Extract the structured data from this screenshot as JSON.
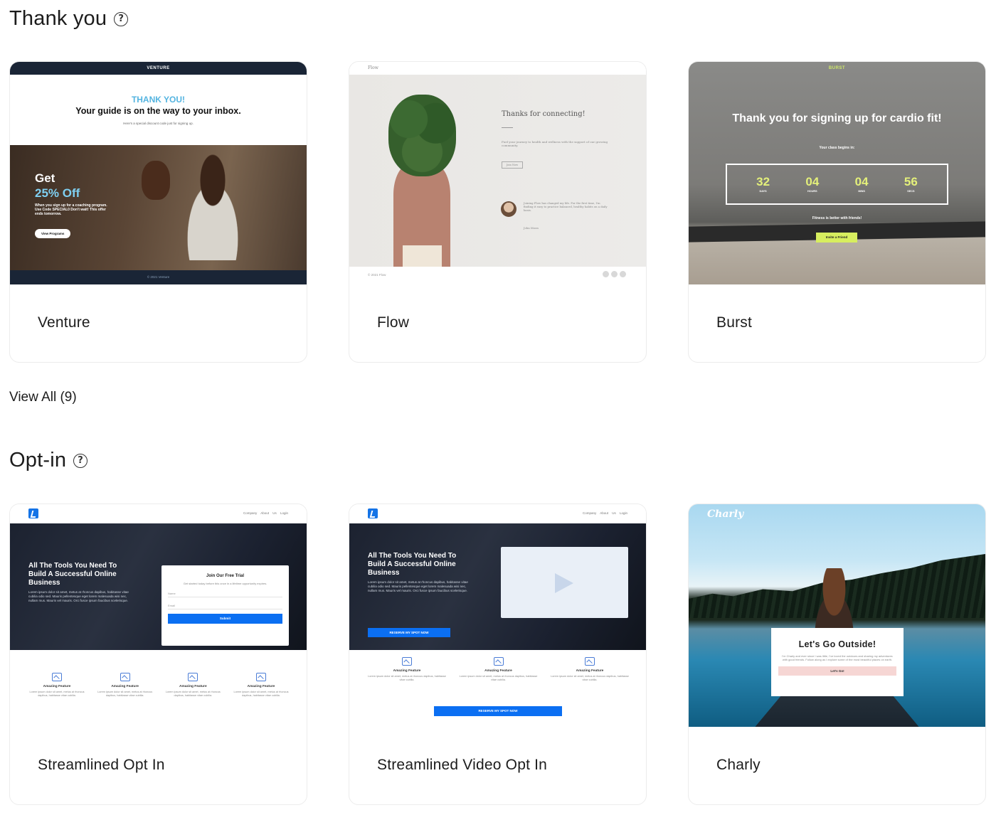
{
  "sections": {
    "thank_you": {
      "title": "Thank you",
      "view_all": "View All (9)",
      "cards": [
        {
          "label": "Venture",
          "preview": {
            "brand": "VENTURE",
            "heading": "THANK YOU!",
            "subheading": "Your guide is on the way to your inbox.",
            "small": "Here's a special discount code just for signing up.",
            "promo_get": "Get",
            "promo_off": "25% Off",
            "promo_copy": "When you sign up for a coaching program. Use Code SPECIAL0 Don't wait! This offer ends tomorrow.",
            "button": "View Programs",
            "footer": "© 2021 Venture"
          }
        },
        {
          "label": "Flow",
          "preview": {
            "brand": "Flow",
            "heading": "Thanks for connecting!",
            "body": "Fuel your journey to health and wellness with the support of our growing community.",
            "button": "Join Now",
            "quote": "Joining Flow has changed my life. For the first time, I'm finding it easy to practice balanced, healthy habits on a daily basis.",
            "author": "John Moon",
            "footer": "© 2021 Flow"
          }
        },
        {
          "label": "Burst",
          "preview": {
            "brand": "BURST",
            "heading": "Thank you for signing up for cardio fit!",
            "subheading": "Your class begins in:",
            "countdown": [
              {
                "value": "32",
                "unit": "DAYS"
              },
              {
                "value": "04",
                "unit": "HOURS"
              },
              {
                "value": "04",
                "unit": "MINS"
              },
              {
                "value": "56",
                "unit": "SECS"
              }
            ],
            "tagline": "Fitness is better with friends!",
            "button": "Invite a Friend"
          }
        }
      ]
    },
    "opt_in": {
      "title": "Opt-in",
      "cards": [
        {
          "label": "Streamlined Opt In",
          "preview": {
            "nav": "Company  About Us  Login",
            "heading": "All The Tools You Need To Build A Successful Online Business",
            "body": "Lorem ipsum dolor sit amet, metus at rhoncus dapibus, habitasse vitae cubilia odio sed. Mauris pellentesque eget lorem malesuada wisi nec, nullam mus. Mauris vel mauris. Orci fusce ipsum faucibus scelerisque.",
            "form_title": "Join Our Free Trial",
            "form_sub": "Get started today before this once in a lifetime opportunity expires.",
            "field_name": "Name",
            "field_email": "Email",
            "submit": "Submit",
            "features": [
              {
                "name": "Amazing Feature",
                "desc": "Lorem ipsum dolor sit amet, metus at rhoncus dapibus, habitasse vitae cubilia."
              },
              {
                "name": "Amazing Feature",
                "desc": "Lorem ipsum dolor sit amet, metus at rhoncus dapibus, habitasse vitae cubilia."
              },
              {
                "name": "Amazing Feature",
                "desc": "Lorem ipsum dolor sit amet, metus at rhoncus dapibus, habitasse vitae cubilia."
              },
              {
                "name": "Amazing Feature",
                "desc": "Lorem ipsum dolor sit amet, metus at rhoncus dapibus, habitasse vitae cubilia."
              }
            ]
          }
        },
        {
          "label": "Streamlined Video Opt In",
          "preview": {
            "nav": "Company  About Us  Login",
            "heading": "All The Tools You Need To Build A Successful Online Business",
            "body": "Lorem ipsum dolor sit amet, metus at rhoncus dapibus, habitasse vitae cubilia odio sed. Mauris pellentesque eget lorem malesuada wisi nec, nullam mus. Mauris vel mauris. Orci fusce ipsum faucibus scelerisque.",
            "button": "RESERVE MY SPOT NOW",
            "features": [
              {
                "name": "Amazing Feature",
                "desc": "Lorem ipsum dolor sit amet, metus at rhoncus dapibus, habitasse vitae cubilia."
              },
              {
                "name": "Amazing Feature",
                "desc": "Lorem ipsum dolor sit amet, metus at rhoncus dapibus, habitasse vitae cubilia."
              },
              {
                "name": "Amazing Feature",
                "desc": "Lorem ipsum dolor sit amet, metus at rhoncus dapibus, habitasse vitae cubilia."
              }
            ],
            "bottom_button": "RESERVE MY SPOT NOW"
          }
        },
        {
          "label": "Charly",
          "preview": {
            "brand": "Charly",
            "heading": "Let's Go Outside!",
            "body": "I'm Charly and ever since I was little, I've loved the outdoors and sharing my adventures with good friends. Follow along as I explore some of the most beautiful places on earth.",
            "button": "Let's Go!"
          }
        }
      ]
    }
  },
  "icons": {
    "help": "?"
  },
  "colors": {
    "venture_accent": "#54b4e0",
    "burst_accent": "#d7ee5f",
    "optin_blue": "#0b6ff2",
    "charly_button": "#f6d6d4"
  }
}
